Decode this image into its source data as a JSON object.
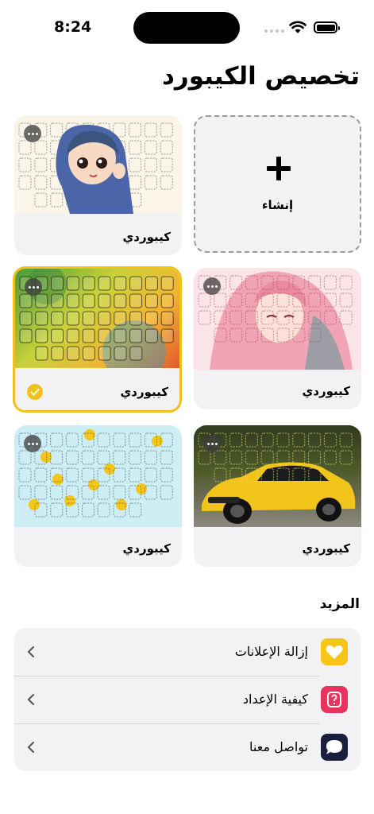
{
  "status_bar": {
    "time": "8:24"
  },
  "header": {
    "title": "تخصيص الكيبورد"
  },
  "create_card": {
    "label": "إنشاء"
  },
  "keyboards": [
    {
      "label": "كيبوردي",
      "theme": "anime-girl-hijab",
      "selected": false
    },
    {
      "label": "كيبوردي",
      "theme": "pink-hair-girl",
      "selected": false
    },
    {
      "label": "كيبوردي",
      "theme": "colorful-gradient",
      "selected": true
    },
    {
      "label": "كيبوردي",
      "theme": "yellow-sports-car",
      "selected": false
    },
    {
      "label": "كيبوردي",
      "theme": "light-blue-smileys",
      "selected": false
    }
  ],
  "more": {
    "title": "المزيد",
    "items": [
      {
        "label": "إزالة الإعلانات",
        "icon": "heart-icon",
        "color": "#f5c518"
      },
      {
        "label": "كيفية الإعداد",
        "icon": "help-icon",
        "color": "#e8335f"
      },
      {
        "label": "تواصل معنا",
        "icon": "chat-icon",
        "color": "#1a1f3d"
      }
    ]
  },
  "colors": {
    "accent": "#f3c11b",
    "card_bg": "#f2f2f4"
  }
}
